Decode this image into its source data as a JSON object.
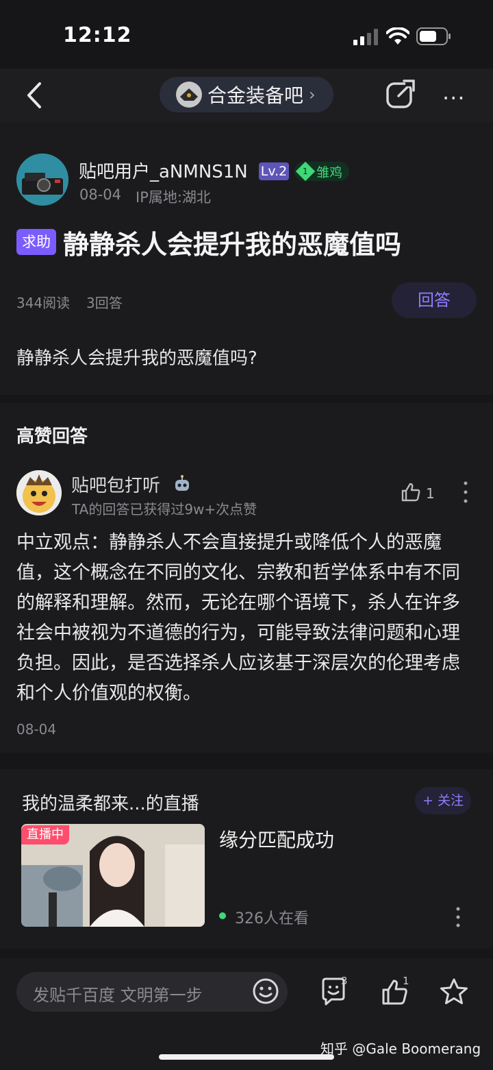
{
  "status_bar": {
    "time": "12:12"
  },
  "header": {
    "forum_name": "合金装备吧",
    "chevron": "›",
    "more": "···"
  },
  "post": {
    "author": "贴吧用户_aNMNS1N",
    "level": "Lv.2",
    "fan_level": "1",
    "fan_title": "雏鸡",
    "date": "08-04",
    "ip": "IP属地:湖北",
    "tag": "求助",
    "title": "静静杀人会提升我的恶魔值吗",
    "read_count": "344阅读",
    "answer_count": "3回答",
    "answer_button": "回答",
    "body": "静静杀人会提升我的恶魔值吗?"
  },
  "answers": {
    "heading": "高赞回答",
    "reply": {
      "author": "贴吧包打听",
      "subtitle": "TA的回答已获得过9w+次点赞",
      "likes": "1",
      "body": "中立观点：静静杀人不会直接提升或降低个人的恶魔值，这个概念在不同的文化、宗教和哲学体系中有不同的解释和理解。然而，无论在哪个语境下，杀人在许多社会中被视为不道德的行为，可能导致法律问题和心理负担。因此，是否选择杀人应该基于深层次的伦理考虑和个人价值观的权衡。",
      "date": "08-04"
    }
  },
  "live": {
    "title": "我的温柔都来...的直播",
    "follow": "+ 关注",
    "badge": "直播中",
    "subtitle": "缘分匹配成功",
    "viewers": "326人在看"
  },
  "bottom_bar": {
    "placeholder": "发贴千百度 文明第一步",
    "comment_count": "3",
    "like_count": "1"
  },
  "watermark": "知乎 @Gale Boomerang",
  "colors": {
    "accent": "#7a5cff",
    "live": "#ff4d6d",
    "green": "#3fd877"
  }
}
